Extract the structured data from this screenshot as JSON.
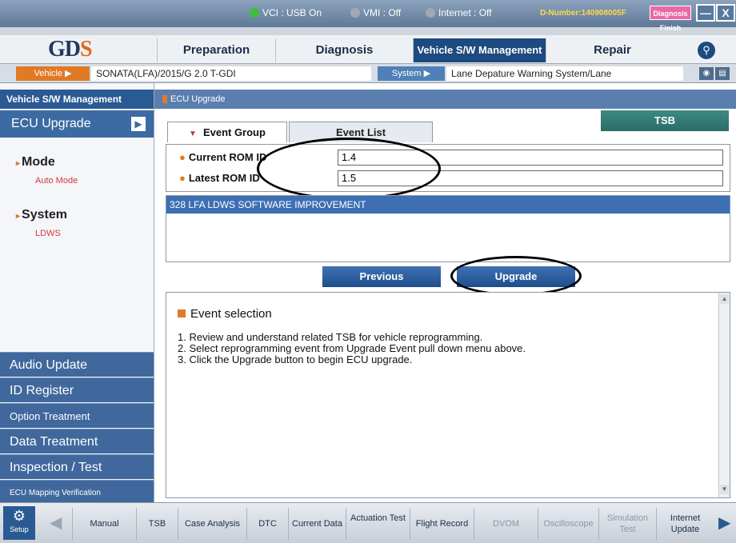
{
  "status": {
    "vci": "VCI : USB On",
    "vmi": "VMI : Off",
    "internet": "Internet : Off",
    "d_number": "D-Number:140908005F",
    "diag": "Diagnosis Finish",
    "minimize": "—",
    "close": "X"
  },
  "menu": {
    "logo_gd": "GD",
    "logo_s": "S",
    "tabs": [
      "Preparation",
      "Diagnosis",
      "Vehicle S/W Management",
      "Repair"
    ]
  },
  "vehicle_bar": {
    "vehicle_label": "Vehicle ▶",
    "vehicle_value": "SONATA(LFA)/2015/G 2.0 T-GDI",
    "system_label": "System ▶",
    "system_value": "Lane Depature Warning System/Lane"
  },
  "sidebar": {
    "header": "Vehicle S/W Management",
    "ecu_upgrade": "ECU Upgrade",
    "mode_label": "Mode",
    "mode_value": "Auto Mode",
    "system_label": "System",
    "system_value": "LDWS",
    "items": [
      "Audio Update",
      "ID Register",
      "Option Treatment",
      "Data Treatment",
      "Inspection / Test",
      "ECU Mapping Verification"
    ]
  },
  "content": {
    "breadcrumb": "ECU Upgrade",
    "tab_event_group": "Event Group",
    "tab_event_list": "Event List",
    "tsb_button": "TSB",
    "current_rom_label": "Current ROM ID",
    "current_rom_value": "1.4",
    "latest_rom_label": "Latest ROM ID",
    "latest_rom_value": "1.5",
    "event_row": "328 LFA LDWS SOFTWARE IMPROVEMENT",
    "previous_button": "Previous",
    "upgrade_button": "Upgrade",
    "info_title": "Event selection",
    "info_lines": [
      "1. Review and understand related TSB for vehicle reprogramming.",
      "2. Select reprogramming event from Upgrade Event pull down menu above.",
      "3. Click the Upgrade button to begin ECU upgrade."
    ]
  },
  "toolbar": {
    "setup": "Setup",
    "buttons": [
      "Manual",
      "TSB",
      "Case Analysis",
      "DTC",
      "Current Data",
      "Actuation Test",
      "Flight Record",
      "DVOM",
      "Oscilloscope",
      "Simulation Test",
      "Internet Update"
    ]
  }
}
